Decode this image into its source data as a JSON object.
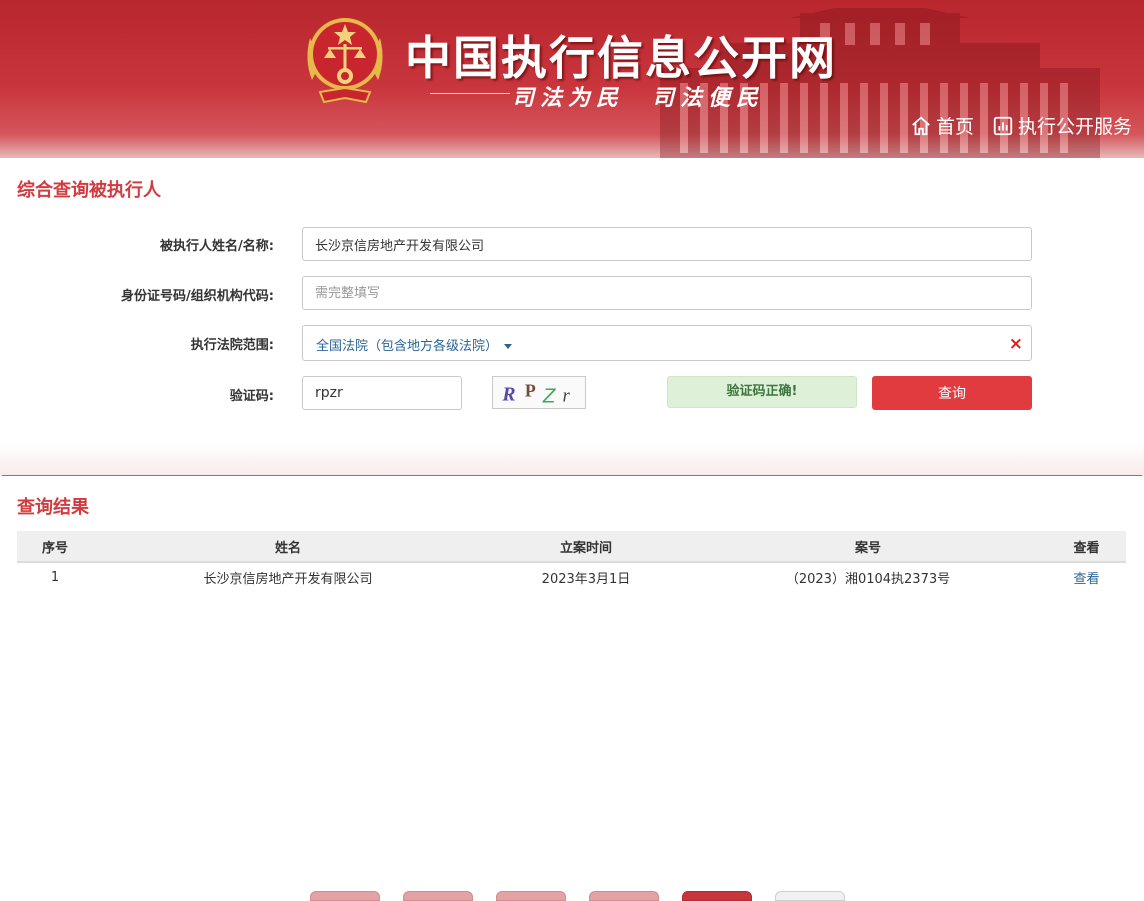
{
  "header": {
    "site_title": "中国执行信息公开网",
    "slogan": "司法为民　司法便民",
    "nav": [
      {
        "label": "首页",
        "icon": "home-icon"
      },
      {
        "label": "执行公开服务",
        "icon": "bar-chart-icon"
      }
    ]
  },
  "query": {
    "title": "综合查询被执行人",
    "name_label": "被执行人姓名/名称:",
    "name_value": "长沙京信房地产开发有限公司",
    "id_label": "身份证号码/组织机构代码:",
    "id_placeholder": "需完整填写",
    "court_label": "执行法院范围:",
    "court_value": "全国法院（包含地方各级法院）",
    "clear_symbol": "×",
    "captcha_label": "验证码:",
    "captcha_value": "rpzr",
    "captcha_image_text": "RPZr",
    "captcha_status": "验证码正确!",
    "submit_label": "查询"
  },
  "results": {
    "title": "查询结果",
    "columns": [
      "序号",
      "姓名",
      "立案时间",
      "案号",
      "查看"
    ],
    "rows": [
      {
        "index": "1",
        "name": "长沙京信房地产开发有限公司",
        "date": "2023年3月1日",
        "case_no": "（2023）湘0104执2373号",
        "action": "查看"
      }
    ]
  },
  "colors": {
    "brand_red": "#c9353c",
    "title_red": "#d23b3f",
    "link_blue": "#2a6496",
    "success_green": "#3c763d"
  }
}
